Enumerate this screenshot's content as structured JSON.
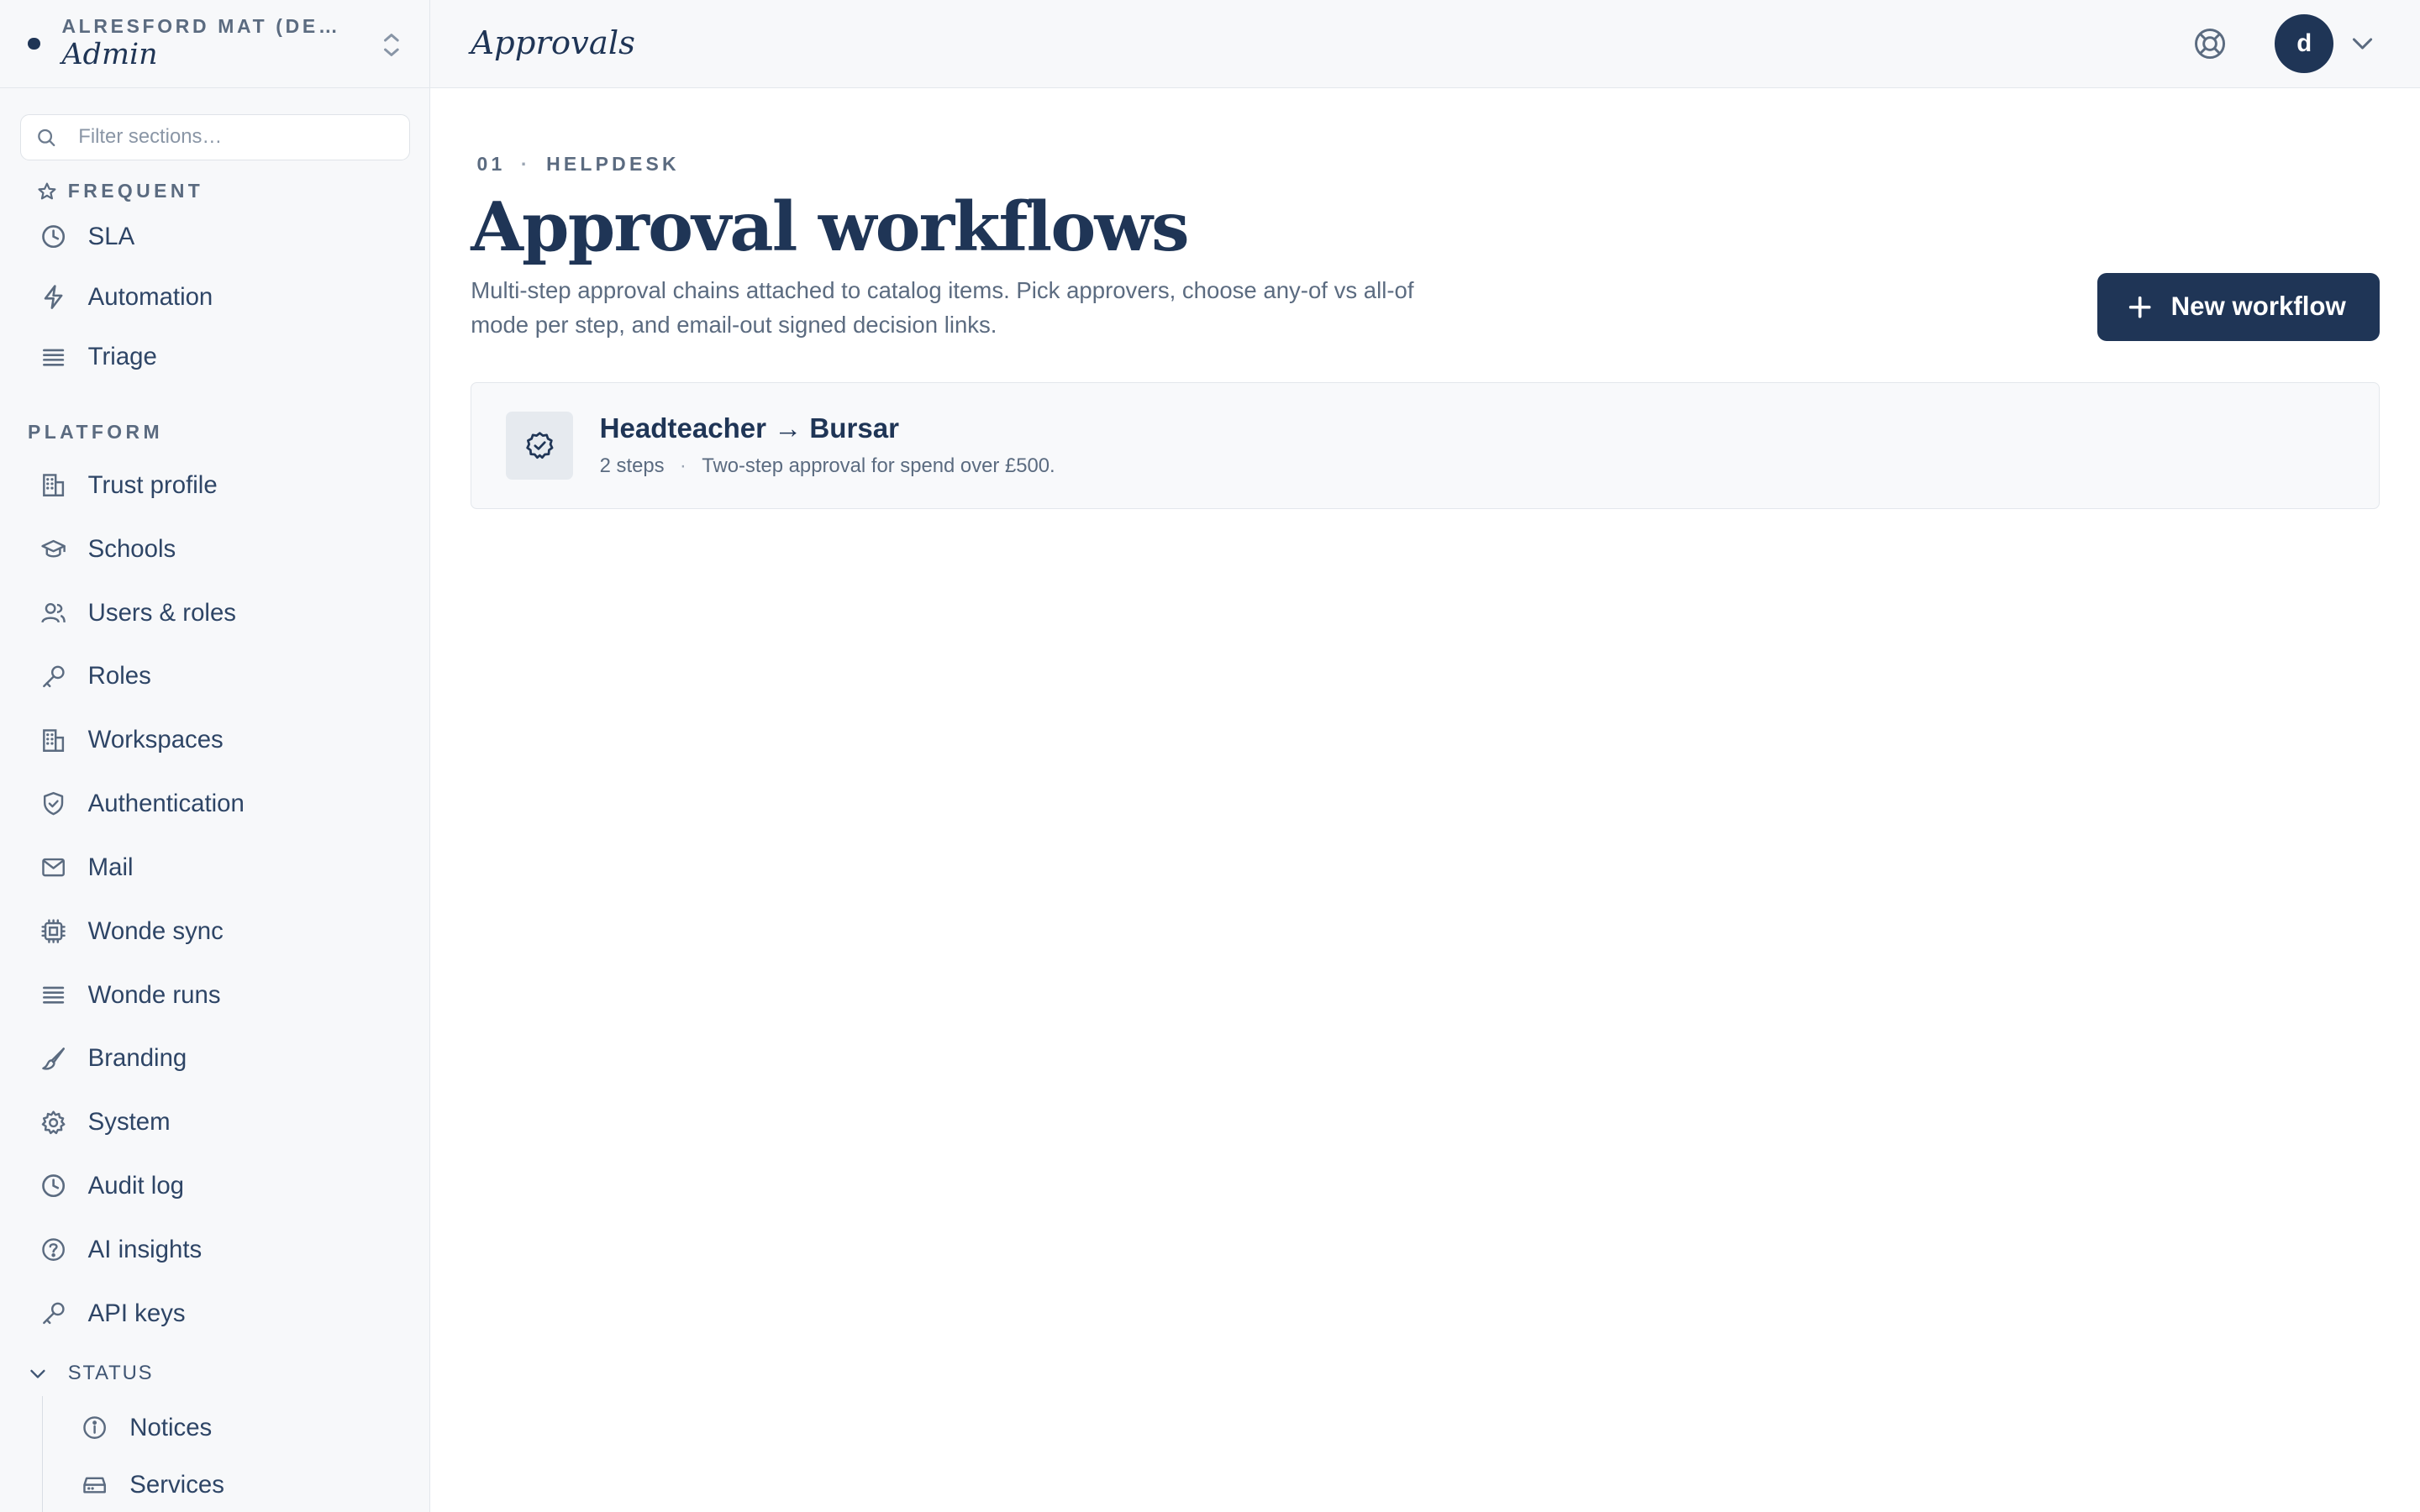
{
  "org": {
    "name": "ALRESFORD MAT (DE…",
    "role": "Admin"
  },
  "sidebar": {
    "filter_placeholder": "Filter sections…",
    "frequent_label": "FREQUENT",
    "frequent_items": [
      {
        "label": "SLA",
        "icon": "clock-icon"
      },
      {
        "label": "Automation",
        "icon": "lightning-icon"
      },
      {
        "label": "Triage",
        "icon": "list-icon"
      }
    ],
    "platform_label": "PLATFORM",
    "platform_items": [
      {
        "label": "Trust profile",
        "icon": "building-icon"
      },
      {
        "label": "Schools",
        "icon": "graduation-cap-icon"
      },
      {
        "label": "Users & roles",
        "icon": "users-icon"
      },
      {
        "label": "Roles",
        "icon": "key-icon"
      },
      {
        "label": "Workspaces",
        "icon": "building-icon"
      },
      {
        "label": "Authentication",
        "icon": "shield-check-icon"
      },
      {
        "label": "Mail",
        "icon": "mail-icon"
      },
      {
        "label": "Wonde sync",
        "icon": "chip-icon"
      },
      {
        "label": "Wonde runs",
        "icon": "list-icon"
      },
      {
        "label": "Branding",
        "icon": "brush-icon"
      },
      {
        "label": "System",
        "icon": "gear-icon"
      },
      {
        "label": "Audit log",
        "icon": "clock-icon"
      },
      {
        "label": "AI insights",
        "icon": "help-circle-icon"
      },
      {
        "label": "API keys",
        "icon": "key-icon"
      }
    ],
    "status_label": "STATUS",
    "status_items": [
      {
        "label": "Notices",
        "icon": "info-icon"
      },
      {
        "label": "Services",
        "icon": "server-icon"
      }
    ]
  },
  "topbar": {
    "title": "Approvals",
    "avatar_initial": "d"
  },
  "page": {
    "crumb_number": "01",
    "crumb_sep": "·",
    "crumb_section": "HELPDESK",
    "title": "Approval workflows",
    "description": "Multi-step approval chains attached to catalog items. Pick approvers, choose any-of vs all-of mode per step, and email-out signed decision links.",
    "new_button": "New workflow"
  },
  "workflows": [
    {
      "name": "Headteacher → Bursar",
      "steps": "2 steps",
      "sep": "·",
      "summary": "Two-step approval for spend over £500."
    }
  ],
  "colors": {
    "brand": "#1f3556",
    "muted": "#5b6b80",
    "sidebar_bg": "#f7f8fa"
  }
}
